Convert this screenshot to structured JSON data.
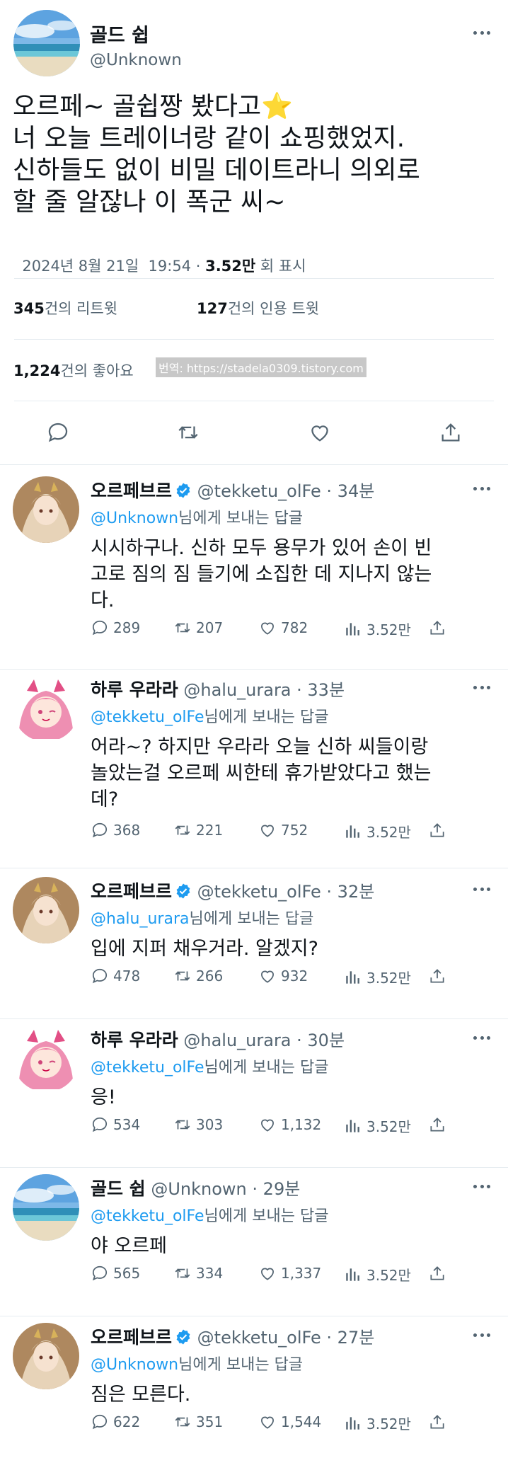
{
  "colors": {
    "link": "#1d9bf0",
    "muted": "#536471",
    "verified": "#1d9bf0"
  },
  "main": {
    "name": "골드 쉽",
    "handle": "@Unknown",
    "text_lines": [
      "오르페~ 골쉽짱 봤다고⭐",
      "너 오늘 트레이너랑 같이 쇼핑했었지.",
      "신하들도 없이 비밀 데이트라니 의외로",
      "할 줄 알잖나 이 폭군 씨~"
    ],
    "date": "2024년 8월 21일  19:54 · ",
    "views": "3.52만",
    "views_label": " 회 표시",
    "retweets": "345",
    "retweets_label": "건의 리트윗",
    "quotes": "127",
    "quotes_label": "건의 인용 트윗",
    "likes": "1,224",
    "likes_label": "건의 좋아요",
    "watermark": "번역: https://stadela0309.tistory.com"
  },
  "replies": [
    {
      "name": "오르페브르",
      "handle": "@tekketu_olFe",
      "time": " · 34분",
      "to": "@Unknown",
      "to_suffix": "님에게 보내는 답글",
      "lines": [
        "시시하구나. 신하 모두 용무가 있어 손이 빈",
        "고로 짐의 짐 들기에 소집한 데 지나지 않는",
        "다."
      ],
      "reply": "289",
      "retweet": "207",
      "like": "782",
      "views": "3.52만"
    },
    {
      "name": "하루 우라라",
      "handle": "@halu_urara",
      "time": " · 33분",
      "to": "@tekketu_olFe",
      "to_suffix": "님에게 보내는 답글",
      "lines": [
        "어라~? 하지만 우라라 오늘 신하 씨들이랑",
        "놀았는걸 오르페 씨한테 휴가받았다고 했는",
        "데?"
      ],
      "reply": "368",
      "retweet": "221",
      "like": "752",
      "views": "3.52만"
    },
    {
      "name": "오르페브르",
      "handle": "@tekketu_olFe",
      "time": " · 32분",
      "to": "@halu_urara",
      "to_suffix": "님에게 보내는 답글",
      "lines": [
        "입에 지퍼 채우거라. 알겠지?"
      ],
      "reply": "478",
      "retweet": "266",
      "like": "932",
      "views": "3.52만"
    },
    {
      "name": "하루 우라라",
      "handle": "@halu_urara",
      "time": " · 30분",
      "to": "@tekketu_olFe",
      "to_suffix": "님에게 보내는 답글",
      "lines": [
        "응!"
      ],
      "reply": "534",
      "retweet": "303",
      "like": "1,132",
      "views": "3.52만"
    },
    {
      "name": "골드 쉽",
      "handle": "@Unknown",
      "time": " · 29분",
      "to": "@tekketu_olFe",
      "to_suffix": "님에게 보내는 답글",
      "lines": [
        "야 오르페"
      ],
      "reply": "565",
      "retweet": "334",
      "like": "1,337",
      "views": "3.52만"
    },
    {
      "name": "오르페브르",
      "handle": "@tekketu_olFe",
      "time": " · 27분",
      "to": "@Unknown",
      "to_suffix": "님에게 보내는 답글",
      "lines": [
        "짐은 모른다."
      ],
      "reply": "622",
      "retweet": "351",
      "like": "1,544",
      "views": "3.52만"
    }
  ]
}
